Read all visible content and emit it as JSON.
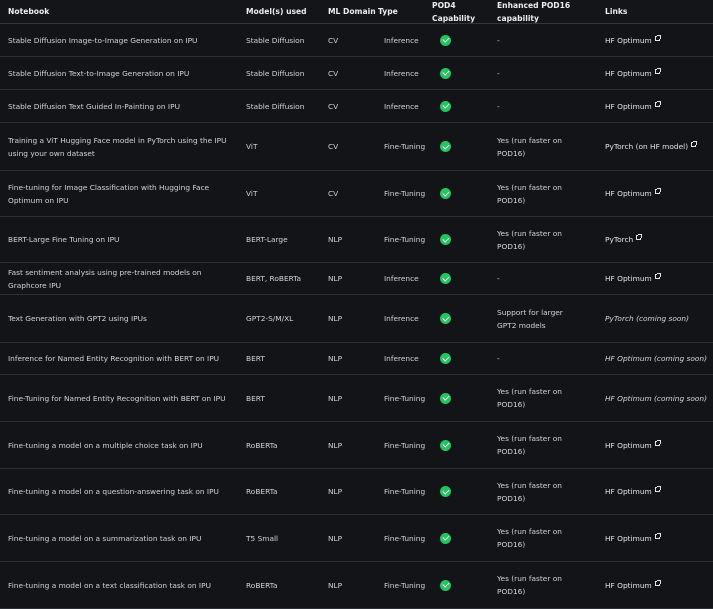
{
  "headers": {
    "notebook": "Notebook",
    "models": "Model(s) used",
    "domain": "ML Domain",
    "type": "Type",
    "pod4": "POD4 Capability",
    "pod16": "Enhanced POD16 capability",
    "links": "Links"
  },
  "rows": [
    {
      "notebook": "Stable Diffusion Image-to-Image Generation on IPU",
      "models": "Stable Diffusion",
      "domain": "CV",
      "type": "Inference",
      "pod16": "-",
      "link": "HF Optimum",
      "link_ext": true,
      "link_italic": false
    },
    {
      "notebook": "Stable Diffusion Text-to-Image Generation on IPU",
      "models": "Stable Diffusion",
      "domain": "CV",
      "type": "Inference",
      "pod16": "-",
      "link": "HF Optimum",
      "link_ext": true,
      "link_italic": false
    },
    {
      "notebook": "Stable Diffusion Text Guided In-Painting on IPU",
      "models": "Stable Diffusion",
      "domain": "CV",
      "type": "Inference",
      "pod16": "-",
      "link": "HF Optimum",
      "link_ext": true,
      "link_italic": false
    },
    {
      "notebook": "Training a ViT Hugging Face model in PyTorch using the IPU using your own dataset",
      "models": "ViT",
      "domain": "CV",
      "type": "Fine-Tuning",
      "pod16": "Yes (run faster on POD16)",
      "link": "PyTorch (on HF model)",
      "link_ext": true,
      "link_italic": false
    },
    {
      "notebook": "Fine-tuning for Image Classification with Hugging Face Optimum on IPU",
      "models": "ViT",
      "domain": "CV",
      "type": "Fine-Tuning",
      "pod16": "Yes (run faster on POD16)",
      "link": "HF Optimum",
      "link_ext": true,
      "link_italic": false
    },
    {
      "notebook": "BERT-Large Fine Tuning on IPU",
      "models": "BERT-Large",
      "domain": "NLP",
      "type": "Fine-Tuning",
      "pod16": "Yes (run faster on POD16)",
      "link": "PyTorch",
      "link_ext": true,
      "link_italic": false
    },
    {
      "notebook": "Fast sentiment analysis using pre-trained models on Graphcore IPU",
      "models": "BERT, RoBERTa",
      "domain": "NLP",
      "type": "Inference",
      "pod16": "-",
      "link": "HF Optimum",
      "link_ext": true,
      "link_italic": false
    },
    {
      "notebook": "Text Generation with GPT2 using IPUs",
      "models": "GPT2-S/M/XL",
      "domain": "NLP",
      "type": "Inference",
      "pod16": "Support for larger GPT2 models",
      "link": "PyTorch (coming soon)",
      "link_ext": false,
      "link_italic": true
    },
    {
      "notebook": "Inference for Named Entity Recognition with BERT on IPU",
      "models": "BERT",
      "domain": "NLP",
      "type": "Inference",
      "pod16": "-",
      "link": "HF Optimum (coming soon)",
      "link_ext": false,
      "link_italic": true
    },
    {
      "notebook": "Fine-Tuning for Named Entity Recognition with BERT on IPU",
      "models": "BERT",
      "domain": "NLP",
      "type": "Fine-Tuning",
      "pod16": "Yes (run faster on POD16)",
      "link": "HF Optimum (coming soon)",
      "link_ext": false,
      "link_italic": true
    },
    {
      "notebook": "Fine-tuning a model on a multiple choice task on IPU",
      "models": "RoBERTa",
      "domain": "NLP",
      "type": "Fine-Tuning",
      "pod16": "Yes (run faster on POD16)",
      "link": "HF Optimum",
      "link_ext": true,
      "link_italic": false
    },
    {
      "notebook": "Fine-tuning a model on a question-answering task on IPU",
      "models": "RoBERTa",
      "domain": "NLP",
      "type": "Fine-Tuning",
      "pod16": "Yes (run faster on POD16)",
      "link": "HF Optimum",
      "link_ext": true,
      "link_italic": false
    },
    {
      "notebook": "Fine-tuning a model on a summarization task on IPU",
      "models": "T5 Small",
      "domain": "NLP",
      "type": "Fine-Tuning",
      "pod16": "Yes (run faster on POD16)",
      "link": "HF Optimum",
      "link_ext": true,
      "link_italic": false
    },
    {
      "notebook": "Fine-tuning a model on a text classification task on IPU",
      "models": "RoBERTa",
      "domain": "NLP",
      "type": "Fine-Tuning",
      "pod16": "Yes (run faster on POD16)",
      "link": "HF Optimum",
      "link_ext": true,
      "link_italic": false
    }
  ],
  "colors": {
    "background": "#131417",
    "check": "#22c55e",
    "divider": "#2c2f36",
    "text": "#d2d5da"
  }
}
